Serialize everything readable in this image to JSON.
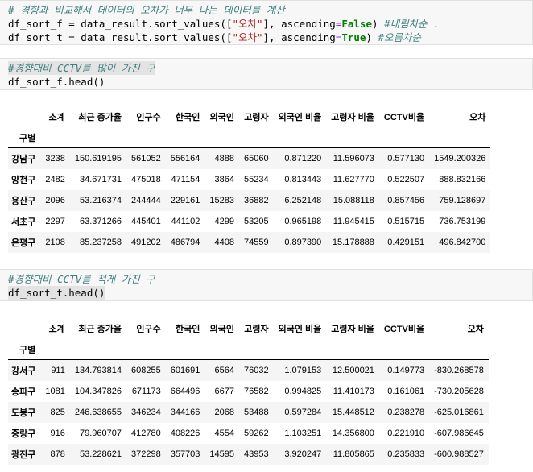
{
  "cell1": {
    "line1_comment": "# 경향과 비교해서 데이터의 오차가 너무 나는 데이터를 계산",
    "line2_a": "df_sort_f = data_result.sort_values([",
    "line2_str": "\"오차\"",
    "line2_b": "], ascending",
    "line2_eq": "=",
    "line2_kw": "False",
    "line2_c": ") ",
    "line2_comment": "#내림차순 .",
    "line3_a": "df_sort_t = data_result.sort_values([",
    "line3_str": "\"오차\"",
    "line3_b": "], ascending",
    "line3_eq": "=",
    "line3_kw": "True",
    "line3_c": ") ",
    "line3_comment": "#오름차순"
  },
  "cell2": {
    "comment": "#경향대비 CCTV를 많이 가진 구",
    "code": "df_sort_f.head()"
  },
  "cell3": {
    "comment": "#경향대비 CCTV를 적게 가진 구",
    "code": "df_sort_t.head()"
  },
  "table_columns": [
    "소계",
    "최근 증가율",
    "인구수",
    "한국인",
    "외국인",
    "고령자",
    "외국인 비율",
    "고령자 비율",
    "CCTV비율",
    "오차"
  ],
  "index_name": "구별",
  "table1": [
    [
      "강남구",
      "3238",
      "150.619195",
      "561052",
      "556164",
      "4888",
      "65060",
      "0.871220",
      "11.596073",
      "0.577130",
      "1549.200326"
    ],
    [
      "양천구",
      "2482",
      "34.671731",
      "475018",
      "471154",
      "3864",
      "55234",
      "0.813443",
      "11.627770",
      "0.522507",
      "888.832166"
    ],
    [
      "용산구",
      "2096",
      "53.216374",
      "244444",
      "229161",
      "15283",
      "36882",
      "6.252148",
      "15.088118",
      "0.857456",
      "759.128697"
    ],
    [
      "서초구",
      "2297",
      "63.371266",
      "445401",
      "441102",
      "4299",
      "53205",
      "0.965198",
      "11.945415",
      "0.515715",
      "736.753199"
    ],
    [
      "은평구",
      "2108",
      "85.237258",
      "491202",
      "486794",
      "4408",
      "74559",
      "0.897390",
      "15.178888",
      "0.429151",
      "496.842700"
    ]
  ],
  "table2": [
    [
      "강서구",
      "911",
      "134.793814",
      "608255",
      "601691",
      "6564",
      "76032",
      "1.079153",
      "12.500021",
      "0.149773",
      "-830.268578"
    ],
    [
      "송파구",
      "1081",
      "104.347826",
      "671173",
      "664496",
      "6677",
      "76582",
      "0.994825",
      "11.410173",
      "0.161061",
      "-730.205628"
    ],
    [
      "도봉구",
      "825",
      "246.638655",
      "346234",
      "344166",
      "2068",
      "53488",
      "0.597284",
      "15.448512",
      "0.238278",
      "-625.016861"
    ],
    [
      "중랑구",
      "916",
      "79.960707",
      "412780",
      "408226",
      "4554",
      "59262",
      "1.103251",
      "14.356800",
      "0.221910",
      "-607.986645"
    ],
    [
      "광진구",
      "878",
      "53.228621",
      "372298",
      "357703",
      "14595",
      "43953",
      "3.920247",
      "11.805865",
      "0.235833",
      "-600.988527"
    ]
  ]
}
